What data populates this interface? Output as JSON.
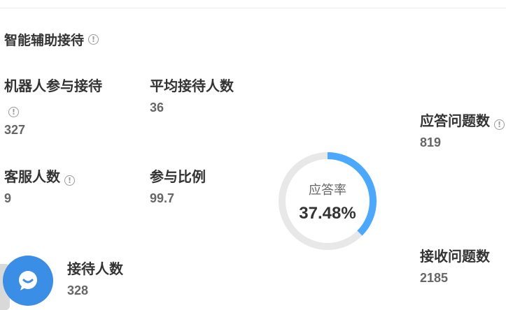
{
  "section": {
    "title": "智能辅助接待",
    "info_icon": "info-circle-icon"
  },
  "stats": {
    "robot_reception": {
      "label": "机器人参与接待",
      "value": "327",
      "has_info": true
    },
    "avg_reception": {
      "label": "平均接待人数",
      "value": "36"
    },
    "agents": {
      "label": "客服人数",
      "value": "9",
      "has_info": true
    },
    "participation_ratio": {
      "label": "参与比例",
      "value": "99.7"
    },
    "served": {
      "label": "接待人数",
      "value": "328"
    },
    "answered_questions": {
      "label": "应答问题数",
      "value": "819",
      "has_info": true
    },
    "received_questions": {
      "label": "接收问题数",
      "value": "2185"
    }
  },
  "gauge": {
    "label": "应答率",
    "value_text": "37.48%",
    "fraction": 0.3748,
    "fill_color": "#4aa8ff",
    "track_color": "#e8e8e8"
  },
  "chat": {
    "icon": "chat-bubble-icon",
    "color": "#3a8ee6"
  }
}
